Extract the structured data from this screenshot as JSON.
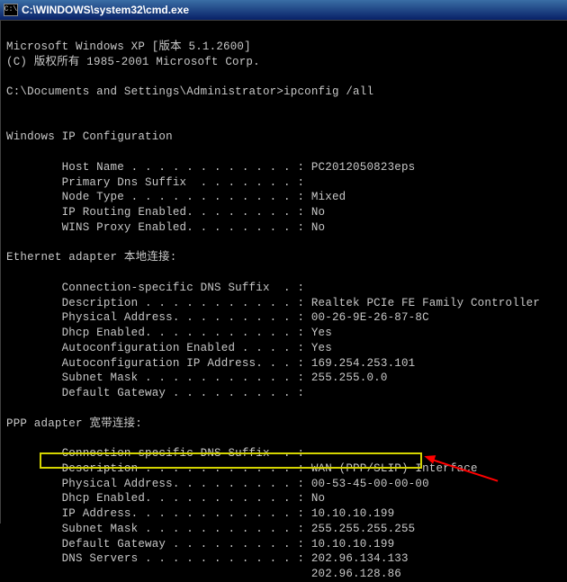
{
  "titleBar": {
    "iconGlyph": "C:\\",
    "title": "C:\\WINDOWS\\system32\\cmd.exe"
  },
  "terminal": {
    "header1": "Microsoft Windows XP [版本 5.1.2600]",
    "header2": "(C) 版权所有 1985-2001 Microsoft Corp.",
    "prompt": "C:\\Documents and Settings\\Administrator>ipconfig /all",
    "section1": "Windows IP Configuration",
    "hostName": "        Host Name . . . . . . . . . . . . : PC2012050823eps",
    "primaryDnsSuffix": "        Primary Dns Suffix  . . . . . . . :",
    "nodeType": "        Node Type . . . . . . . . . . . . : Mixed",
    "ipRouting": "        IP Routing Enabled. . . . . . . . : No",
    "winsProxy": "        WINS Proxy Enabled. . . . . . . . : No",
    "section2": "Ethernet adapter 本地连接:",
    "e_connSuffix": "        Connection-specific DNS Suffix  . :",
    "e_description": "        Description . . . . . . . . . . . : Realtek PCIe FE Family Controller",
    "e_physAddr": "        Physical Address. . . . . . . . . : 00-26-9E-26-87-8C",
    "e_dhcp": "        Dhcp Enabled. . . . . . . . . . . : Yes",
    "e_autoCfgEn": "        Autoconfiguration Enabled . . . . : Yes",
    "e_autoCfgIp": "        Autoconfiguration IP Address. . . : 169.254.253.101",
    "e_subnet": "        Subnet Mask . . . . . . . . . . . : 255.255.0.0",
    "e_gateway": "        Default Gateway . . . . . . . . . :",
    "section3": "PPP adapter 宽带连接:",
    "p_connSuffix": "        Connection-specific DNS Suffix  . :",
    "p_description": "        Description . . . . . . . . . . . : WAN (PPP/SLIP) Interface",
    "p_physAddr": "        Physical Address. . . . . . . . . : 00-53-45-00-00-00",
    "p_dhcp": "        Dhcp Enabled. . . . . . . . . . . : No",
    "p_ipAddr": "        IP Address. . . . . . . . . . . . : 10.10.10.199",
    "p_subnet": "        Subnet Mask . . . . . . . . . . . : 255.255.255.255",
    "p_gateway": "        Default Gateway . . . . . . . . . : 10.10.10.199",
    "p_dns1": "        DNS Servers . . . . . . . . . . . : 202.96.134.133",
    "p_dns2": "                                            202.96.128.86"
  }
}
